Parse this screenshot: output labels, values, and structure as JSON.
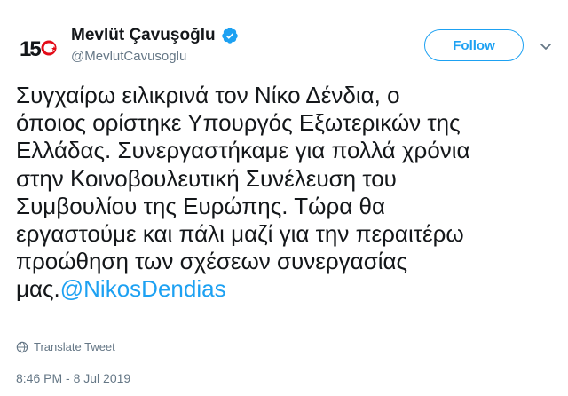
{
  "profile": {
    "avatar_text": "15",
    "display_name": "Mevlüt Çavuşoğlu",
    "handle": "@MevlutCavusoglu",
    "verified_icon": "verified-badge-icon"
  },
  "actions": {
    "follow_label": "Follow",
    "more_icon": "chevron-down-icon"
  },
  "tweet": {
    "lines": [
      "Συγχαίρω ειλικρινά τον Νίκο Δένδια, ο",
      "όποιος ορίστηκε Υπουργός Εξωτερικών της",
      "Ελλάδας. Συνεργαστήκαμε για πολλά χρόνια",
      "στην Κοινοβουλευτική Συνέλευση του",
      "Συμβουλίου της Ευρώπης. Τώρα θα",
      "εργαστούμε και πάλι μαζί για την περαιτέρω",
      "προώθηση των σχέσεων συνεργασίας"
    ],
    "last_line_prefix": "μας.",
    "mention": "@NikosDendias",
    "translate_label": "Translate Tweet",
    "timestamp": "8:46 PM - 8 Jul 2019"
  },
  "colors": {
    "accent": "#1da1f2",
    "text": "#14171a",
    "secondary": "#657786",
    "logo_red": "#e30a17"
  }
}
